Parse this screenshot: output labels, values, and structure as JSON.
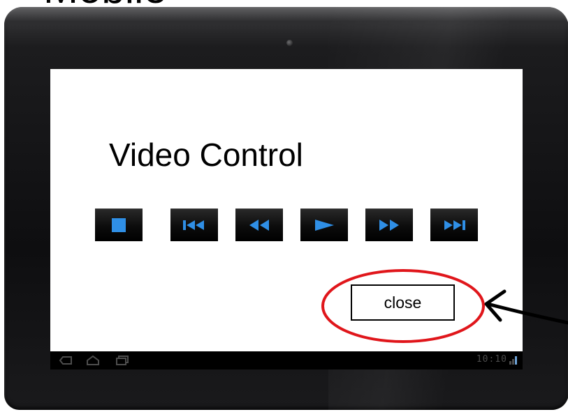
{
  "slide": {
    "heading": "Mobile"
  },
  "screen": {
    "title": "Video Control",
    "controls": [
      {
        "name": "stop",
        "icon": "stop-icon"
      },
      {
        "name": "skip-back",
        "icon": "skip-back-icon"
      },
      {
        "name": "rewind",
        "icon": "rewind-icon"
      },
      {
        "name": "play",
        "icon": "play-icon"
      },
      {
        "name": "fast-forward",
        "icon": "fast-forward-icon"
      },
      {
        "name": "skip-forward",
        "icon": "skip-forward-icon"
      }
    ],
    "close_label": "close"
  },
  "system_bar": {
    "clock": "10:10",
    "nav_icons": [
      "back-icon",
      "home-icon",
      "recent-apps-icon"
    ],
    "status_icon": "signal-icon"
  },
  "colors": {
    "control_icon": "#2f8fe6",
    "highlight_ellipse": "#e0161b",
    "annotation_arrow": "#000000",
    "screen_background": "#ffffff",
    "tablet_bezel": "#161618"
  }
}
